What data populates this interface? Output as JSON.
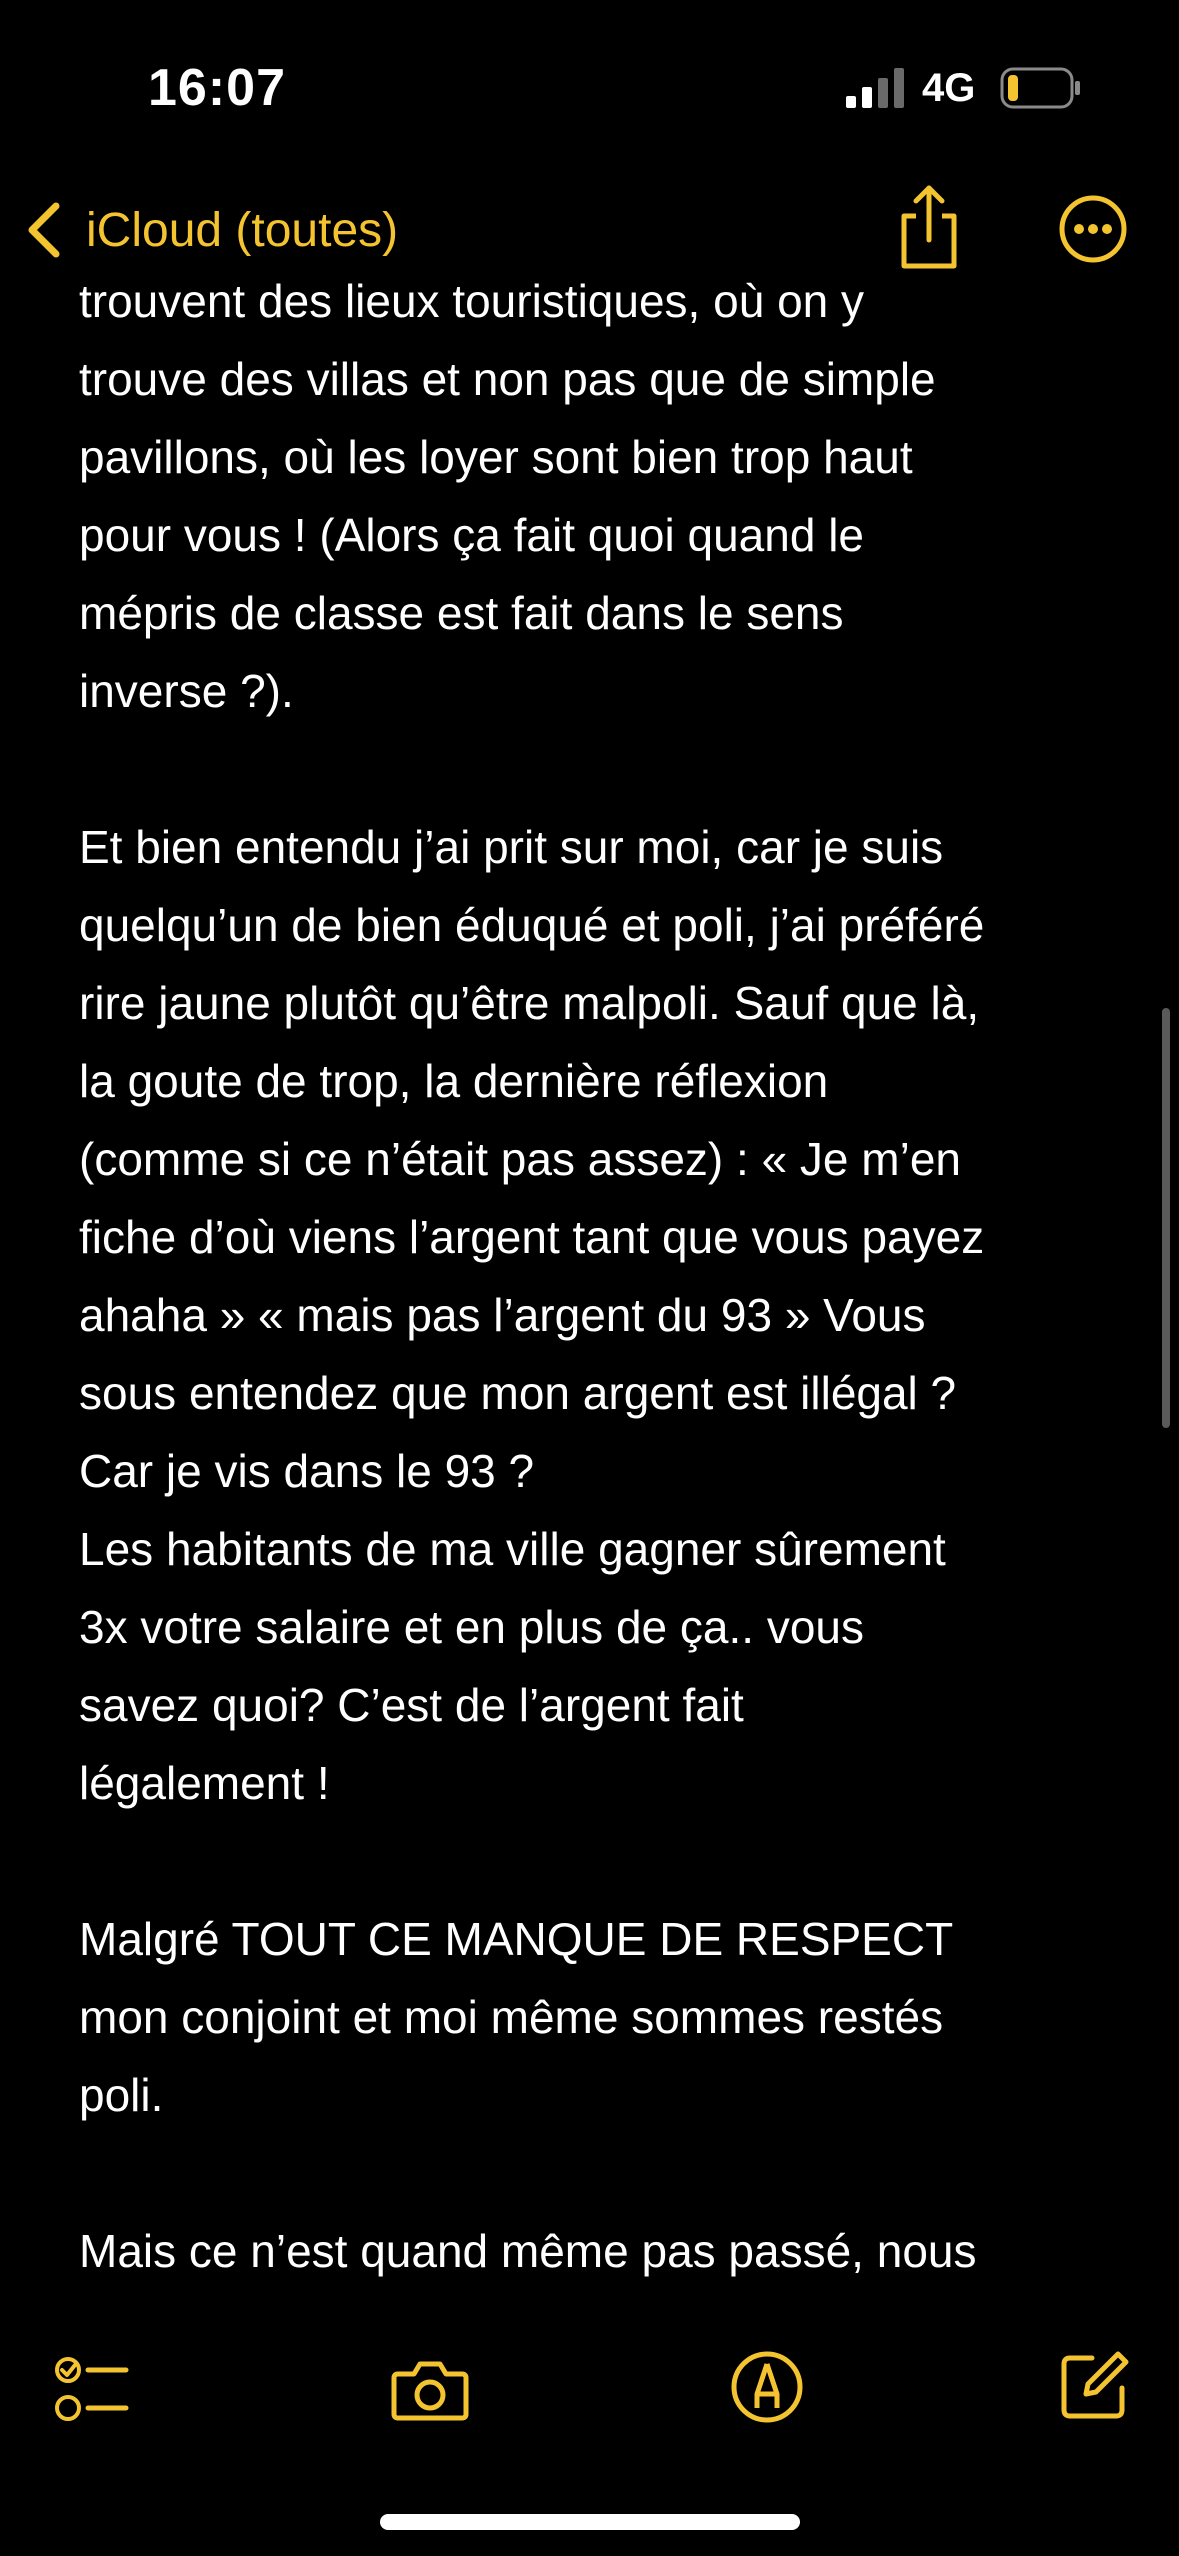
{
  "status_bar": {
    "time": "16:07",
    "network": "4G",
    "signal_icon": "cellular-signal-icon",
    "battery_icon": "battery-low-icon"
  },
  "nav": {
    "back_label": "iCloud (toutes)",
    "back_icon": "chevron-left-icon",
    "share_icon": "share-icon",
    "more_icon": "ellipsis-circle-icon"
  },
  "note": {
    "lines": [
      "trouvent des lieux touristiques, où on y",
      "trouve des villas et non pas que de simple",
      "pavillons, où les loyer sont bien trop haut",
      "pour vous ! (Alors ça fait quoi quand le",
      "mépris de classe est fait dans le sens",
      "inverse ?).",
      "",
      "Et bien entendu j’ai prit sur moi, car je suis",
      "quelqu’un de bien éduqué et poli, j’ai préféré",
      "rire jaune plutôt qu’être malpoli. Sauf que là,",
      "la goute de trop, la dernière réflexion",
      "(comme si ce n’était pas assez) : « Je m’en",
      "fiche d’où viens l’argent tant que vous payez",
      "ahaha » « mais pas l’argent du 93 » Vous",
      "sous entendez que mon argent est illégal ?",
      "Car je vis dans le 93 ?",
      "Les habitants de ma ville gagner sûrement",
      "3x votre salaire et en plus de ça.. vous",
      "savez quoi? C’est de l’argent fait",
      "légalement !",
      "",
      "Malgré TOUT CE MANQUE DE RESPECT",
      "mon conjoint et moi même sommes restés",
      "poli.",
      "",
      "Mais ce n’est quand même pas passé, nous"
    ]
  },
  "toolbar": {
    "checklist_icon": "checklist-icon",
    "camera_icon": "camera-icon",
    "markup_icon": "markup-pen-icon",
    "compose_icon": "compose-icon"
  },
  "colors": {
    "accent": "#f4c430",
    "background": "#000000",
    "text": "#ffffff"
  }
}
